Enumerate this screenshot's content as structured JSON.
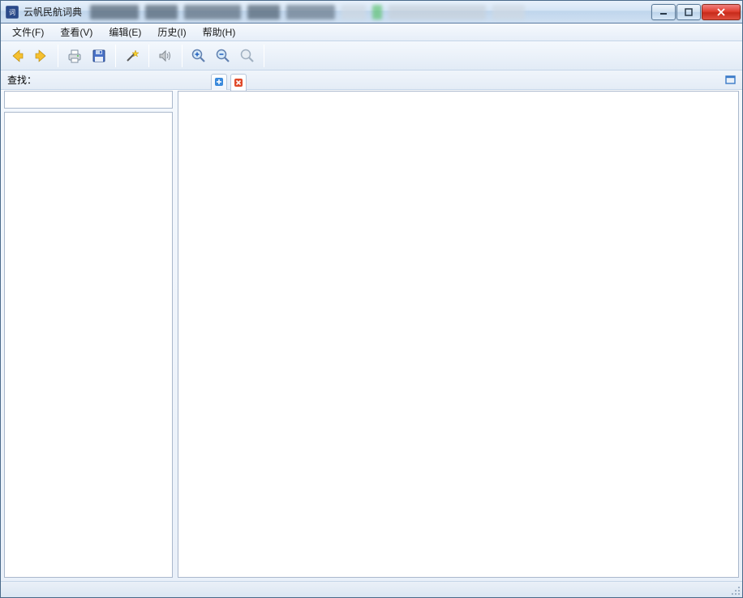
{
  "window": {
    "title": "云帆民航词典"
  },
  "menu": {
    "file": "文件(F)",
    "view": "查看(V)",
    "edit": "编辑(E)",
    "history": "历史(I)",
    "help": "帮助(H)"
  },
  "toolbar": {
    "back": "back",
    "forward": "forward",
    "print": "print",
    "save": "save",
    "wand": "wand",
    "sound": "sound",
    "zoom_in": "zoom-in",
    "zoom_out": "zoom-out",
    "zoom_reset": "zoom-reset"
  },
  "search": {
    "label": "查找：",
    "value": ""
  },
  "tabs": {
    "add_icon": "plus",
    "close_icon": "close"
  },
  "list": {
    "items": []
  },
  "content": {
    "text": ""
  }
}
